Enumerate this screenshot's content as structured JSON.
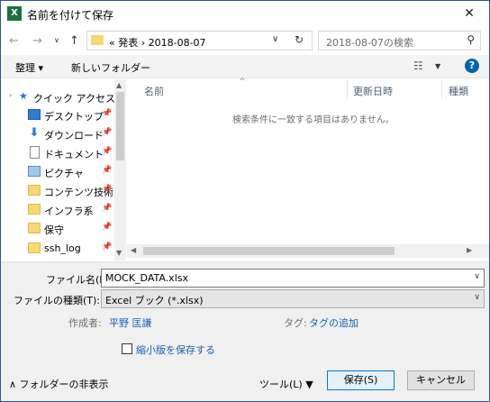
{
  "window": {
    "title": "名前を付けて保存",
    "app_icon": "X",
    "close": "✕"
  },
  "nav": {
    "back": "←",
    "forward": "→",
    "history": "∨",
    "up": "↑"
  },
  "address": {
    "path": "«  発表  ›  2018-08-07",
    "dropdown": "∨",
    "refresh": "↻"
  },
  "search": {
    "placeholder": "2018-08-07の検索",
    "icon": "⚲"
  },
  "toolbar": {
    "organize": "整理 ▾",
    "new_folder": "新しいフォルダー",
    "view_icon": "☷",
    "view_dd": "▼",
    "help": "?"
  },
  "sidebar": {
    "quick_access": {
      "caret": "›",
      "star": "★",
      "label": "クイック アクセス"
    },
    "pin": "📌",
    "items": [
      {
        "label": "デスクトップ",
        "icon": "desktop-icon"
      },
      {
        "label": "ダウンロード",
        "icon": "download-icon"
      },
      {
        "label": "ドキュメント",
        "icon": "document-icon"
      },
      {
        "label": "ピクチャ",
        "icon": "picture-icon"
      },
      {
        "label": "コンテンツ技術",
        "icon": "folder-icon"
      },
      {
        "label": "インフラ系",
        "icon": "folder-icon"
      },
      {
        "label": "保守",
        "icon": "folder-icon"
      },
      {
        "label": "ssh_log",
        "icon": "folder-icon"
      }
    ],
    "scroll_up": "▲",
    "scroll_down": "▼"
  },
  "filelist": {
    "columns": [
      "名前",
      "更新日時",
      "種類"
    ],
    "sort_indicator": "^",
    "empty_message": "検索条件に一致する項目はありません。",
    "scroll_left": "◀",
    "scroll_right": "▶"
  },
  "form": {
    "filename_label": "ファイル名(N):",
    "filename_value": "MOCK_DATA.xlsx",
    "filetype_label": "ファイルの種類(T):",
    "filetype_value": "Excel ブック (*.xlsx)",
    "dropdown": "∨",
    "author_label": "作成者:",
    "author_value": "平野 匡謙",
    "tags_label": "タグ:",
    "tags_value": "タグの追加",
    "thumbnail_label": "縮小版を保存する",
    "thumbnail_checked": false,
    "hide_folders": "∧  フォルダーの非表示",
    "tools": "ツール(L)    ▼",
    "save": "保存(S)",
    "cancel": "キャンセル"
  },
  "colors": {
    "accent": "#0078d7",
    "link": "#1a5fb4",
    "folder": "#f8d775",
    "excel": "#1e7145"
  }
}
